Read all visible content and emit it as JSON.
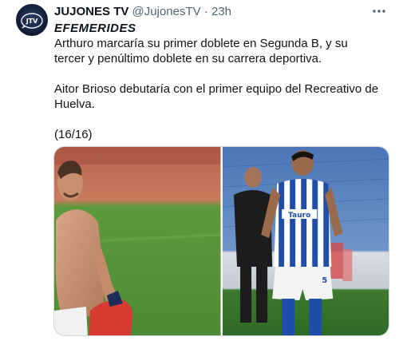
{
  "tweet": {
    "display_name": "JUJONES TV",
    "handle": "@JujonesTV",
    "separator": "·",
    "timestamp": "23h",
    "heading": "EFEMERIDES",
    "paragraph1": "Arthuro marcaría su primer doblete en Segunda B, y su tercer y penúltimo doblete en su carrera deportiva.",
    "paragraph2": "Aitor Brioso debutaría con el primer equipo del Recreativo de Huelva.",
    "paragraph3": "(16/16)"
  },
  "avatar": {
    "logo_text": "JTV"
  },
  "media": {
    "photo2_jersey_text": "Tauro",
    "photo2_number": "5"
  },
  "icons": {
    "more": "more-options-icon"
  },
  "colors": {
    "text": "#0f1419",
    "secondary": "#536471",
    "recreativo_blue": "#1f4ea8"
  }
}
